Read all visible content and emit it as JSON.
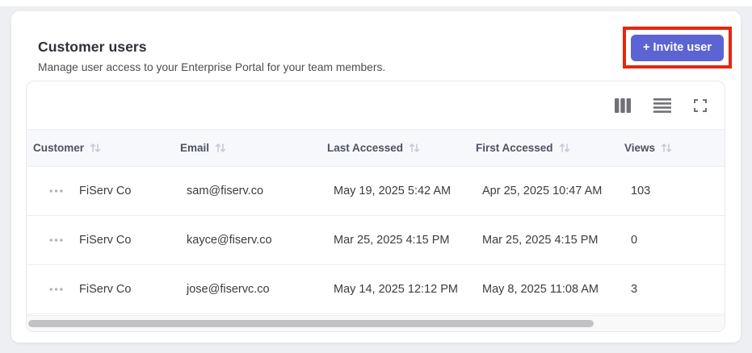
{
  "header": {
    "title": "Customer users",
    "subtitle": "Manage user access to your Enterprise Portal for your team members.",
    "invite_button": "+ Invite user"
  },
  "toolbar": {
    "icons": [
      {
        "name": "columns"
      },
      {
        "name": "row-density"
      },
      {
        "name": "fullscreen"
      }
    ]
  },
  "table": {
    "columns": [
      {
        "label": "Customer",
        "sortable": true
      },
      {
        "label": "Email",
        "sortable": true
      },
      {
        "label": "Last Accessed",
        "sortable": true
      },
      {
        "label": "First Accessed",
        "sortable": true
      },
      {
        "label": "Views",
        "sortable": true
      }
    ],
    "rows": [
      {
        "customer": "FiServ Co",
        "email": "sam@fiserv.co",
        "last_accessed": "May 19, 2025 5:42 AM",
        "first_accessed": "Apr 25, 2025 10:47 AM",
        "views": "103"
      },
      {
        "customer": "FiServ Co",
        "email": "kayce@fiserv.co",
        "last_accessed": "Mar 25, 2025 4:15 PM",
        "first_accessed": "Mar 25, 2025 4:15 PM",
        "views": "0"
      },
      {
        "customer": "FiServ Co",
        "email": "jose@fiservc.co",
        "last_accessed": "May 14, 2025 12:12 PM",
        "first_accessed": "May 8, 2025 11:08 AM",
        "views": "3"
      }
    ]
  },
  "colors": {
    "accent": "#5c63d3",
    "annotation_highlight": "#e8250c",
    "header_bg": "#f7f8fb"
  }
}
